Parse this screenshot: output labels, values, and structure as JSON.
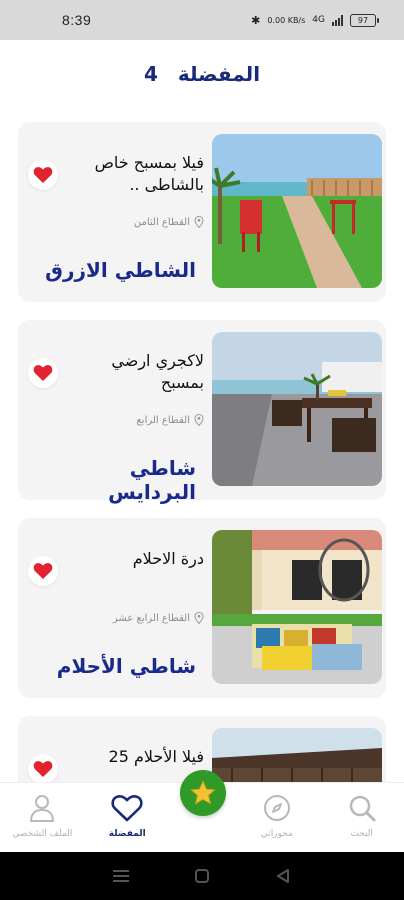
{
  "status_bar": {
    "time": "8:39",
    "data_speed": "0.00 KB/s",
    "network": "4G",
    "battery": "97"
  },
  "header": {
    "title": "المفضلة",
    "count": "4"
  },
  "cards": [
    {
      "title": "فيلا بمسبح خاص بالشاطى ..",
      "location": "القطاع الثامن",
      "beach": "الشاطي الازرق",
      "favorited": true
    },
    {
      "title": "لاكجري ارضي بمسبح",
      "location": "القطاع الرابع",
      "beach": "شاطي البردايس",
      "favorited": true
    },
    {
      "title": "درة الاحلام",
      "location": "القطاع الرابع عشر",
      "beach": "شاطي الأحلام",
      "favorited": true
    },
    {
      "title": "فيلا الأحلام 25",
      "location": "",
      "beach": "",
      "favorited": true
    }
  ],
  "bottom_nav": {
    "items": [
      {
        "label": "البحث",
        "icon": "search-icon",
        "active": false
      },
      {
        "label": "مجوراتي",
        "icon": "compass-icon",
        "active": false
      },
      {
        "label": "المفضلة",
        "icon": "heart-icon",
        "active": true
      },
      {
        "label": "الملف الشخصي",
        "icon": "user-icon",
        "active": false
      }
    ],
    "fab_icon": "star-icon"
  },
  "colors": {
    "accent": "#1a2a7a",
    "heart": "#e0232e",
    "fab": "#2f9a27"
  }
}
